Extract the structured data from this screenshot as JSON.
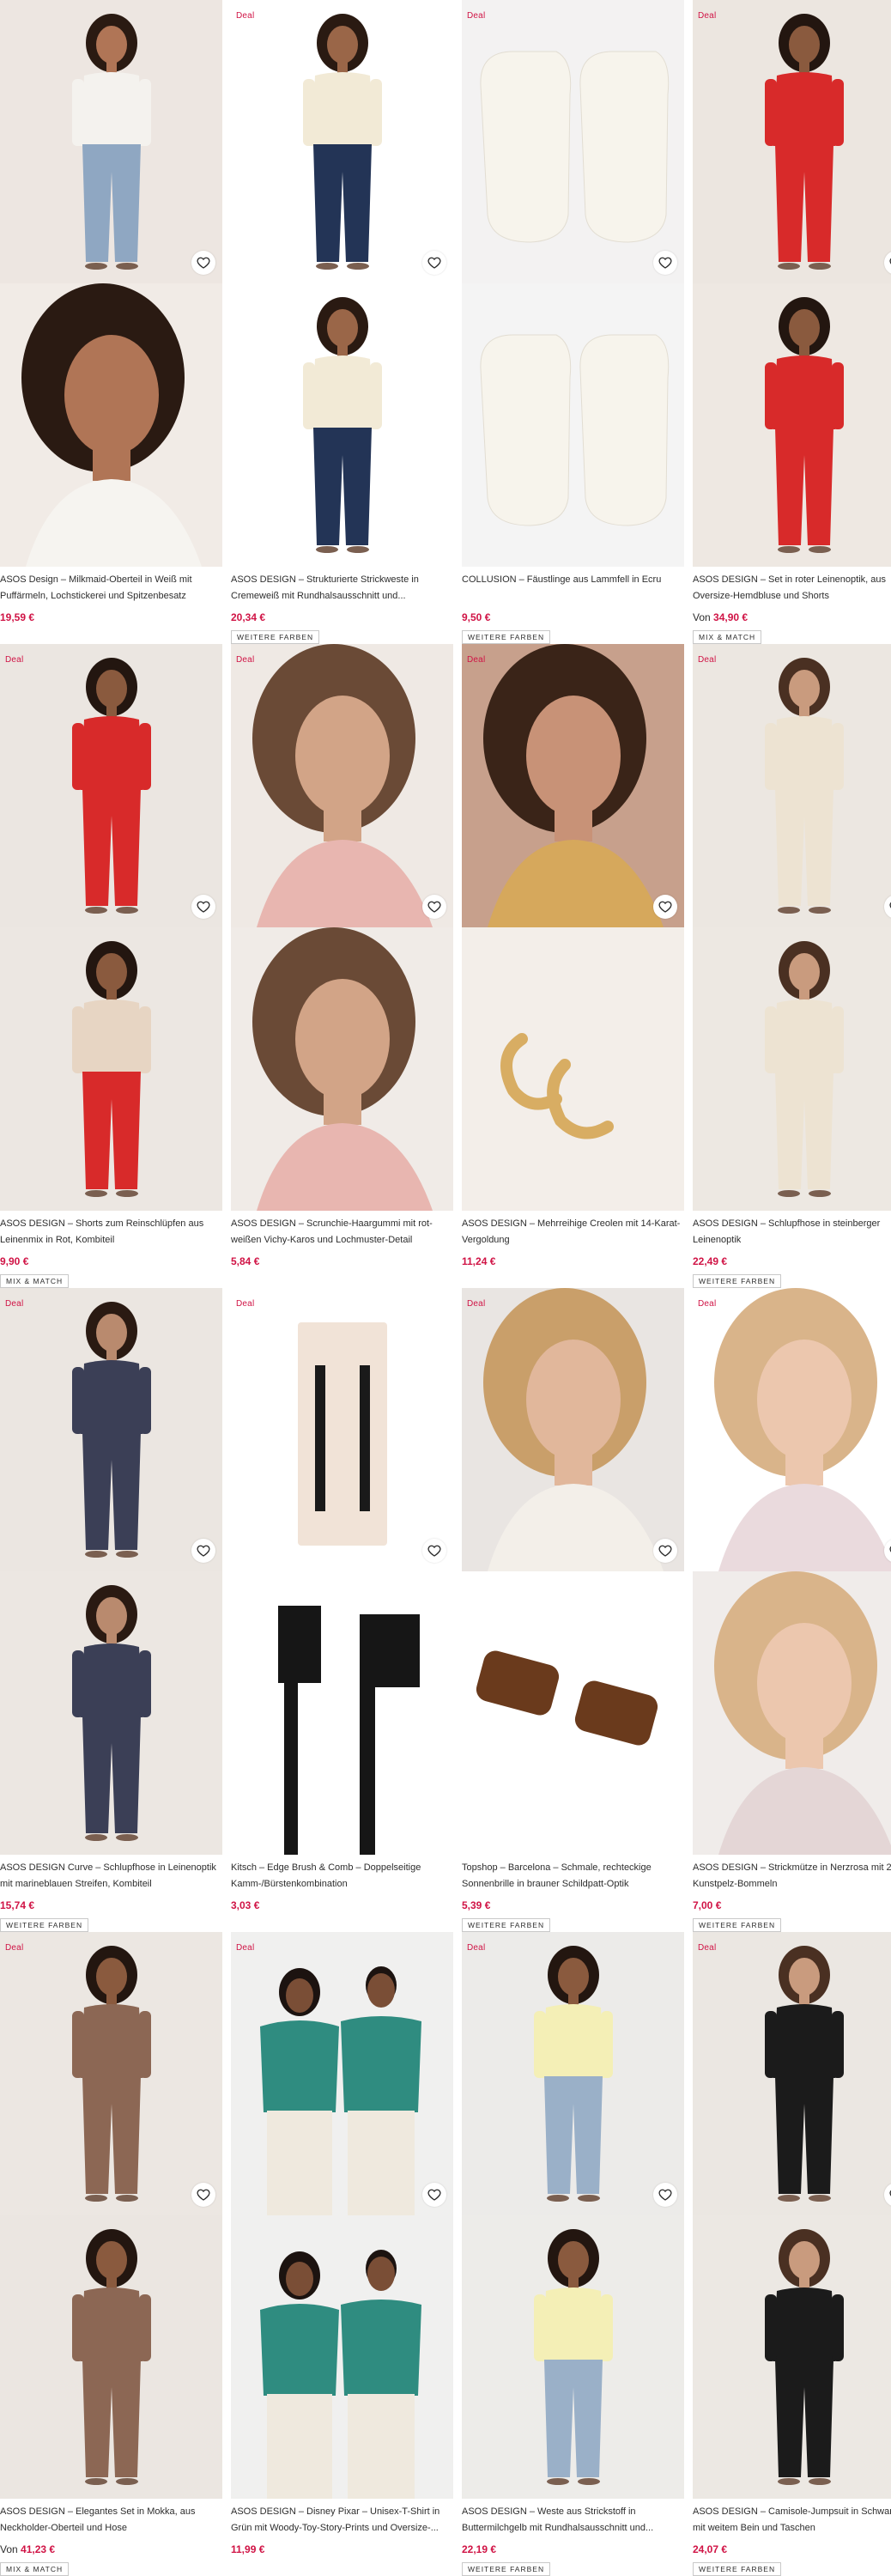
{
  "colors": {
    "accent": "#d01345",
    "text": "#2d2d2d"
  },
  "labels": {
    "deal": "Deal"
  },
  "products": [
    {
      "title": "ASOS Design – Milkmaid-Oberteil in Weiß mit Puffärmeln, Lochstickerei und Spitzenbesatz",
      "price": "19,59 €",
      "price_prefix": "",
      "tag": "",
      "deal": false,
      "top": {
        "bg": "#ede6e1",
        "fig": "woman",
        "skin": "#b07556",
        "hair": "#2a1a12",
        "cloth": "#f4f2ee",
        "pants": "#8fa7c2"
      },
      "bottom": {
        "bg": "#f1ebe6",
        "fig": "closeup",
        "skin": "#b07556",
        "hair": "#2a1a12",
        "cloth": "#f6f4f0",
        "pants": "#f6f4f0"
      }
    },
    {
      "title": "ASOS DESIGN – Strukturierte Strickweste in Cremeweiß mit Rundhalsausschnitt und...",
      "price": "20,34 €",
      "price_prefix": "",
      "tag": "WEITERE FARBEN",
      "deal": true,
      "top": {
        "bg": "#ffffff",
        "fig": "woman",
        "skin": "#9a6648",
        "hair": "#2a1a12",
        "cloth": "#f2ead6",
        "pants": "#233456"
      },
      "bottom": {
        "bg": "#ffffff",
        "fig": "woman",
        "skin": "#9a6648",
        "hair": "#2a1a12",
        "cloth": "#f2ead6",
        "pants": "#233456"
      }
    },
    {
      "title": "COLLUSION – Fäustlinge aus Lammfell in Ecru",
      "price": "9,50 €",
      "price_prefix": "",
      "tag": "WEITERE FARBEN",
      "deal": true,
      "top": {
        "bg": "#f3f2f2",
        "fig": "mittens",
        "skin": "",
        "hair": "",
        "cloth": "#f7f4ec",
        "pants": ""
      },
      "bottom": {
        "bg": "#f4f4f4",
        "fig": "mittens",
        "skin": "",
        "hair": "",
        "cloth": "#f7f4ec",
        "pants": ""
      }
    },
    {
      "title": "ASOS DESIGN – Set in roter Leinenoptik, aus Oversize-Hemdbluse und Shorts",
      "price": "34,90 €",
      "price_prefix": "Von",
      "tag": "MIX & MATCH",
      "deal": true,
      "top": {
        "bg": "#ece6e0",
        "fig": "woman",
        "skin": "#8a5a3e",
        "hair": "#231610",
        "cloth": "#d82a2a",
        "pants": "#d82a2a"
      },
      "bottom": {
        "bg": "#eee8e2",
        "fig": "woman",
        "skin": "#8a5a3e",
        "hair": "#231610",
        "cloth": "#d82a2a",
        "pants": "#d82a2a"
      }
    },
    {
      "title": "ASOS DESIGN – Shorts zum Reinschlüpfen aus Leinenmix in Rot, Kombiteil",
      "price": "9,90 €",
      "price_prefix": "",
      "tag": "MIX & MATCH",
      "deal": true,
      "top": {
        "bg": "#ebe6e1",
        "fig": "woman",
        "skin": "#8a5a3e",
        "hair": "#231610",
        "cloth": "#d82a2a",
        "pants": "#d82a2a"
      },
      "bottom": {
        "bg": "#ece7e2",
        "fig": "woman",
        "skin": "#8a5a3e",
        "hair": "#231610",
        "cloth": "#e7d5c3",
        "pants": "#d82a2a"
      }
    },
    {
      "title": "ASOS DESIGN – Scrunchie-Haargummi mit rot-weißen Vichy-Karos und Lochmuster-Detail",
      "price": "5,84 €",
      "price_prefix": "",
      "tag": "",
      "deal": true,
      "top": {
        "bg": "#efe9e4",
        "fig": "closeup",
        "skin": "#d2a487",
        "hair": "#6a4a36",
        "cloth": "#e8b6b0",
        "pants": "#e8b6b0"
      },
      "bottom": {
        "bg": "#f0ebe7",
        "fig": "closeup",
        "skin": "#d2a487",
        "hair": "#6a4a36",
        "cloth": "#e8b6b0",
        "pants": "#e8b6b0"
      }
    },
    {
      "title": "ASOS DESIGN – Mehrreihige Creolen mit 14-Karat-Vergoldung",
      "price": "11,24 €",
      "price_prefix": "",
      "tag": "",
      "deal": true,
      "top": {
        "bg": "#c7a08c",
        "fig": "closeup",
        "skin": "#c89277",
        "hair": "#3a2418",
        "cloth": "#d6a85c",
        "pants": "#d6a85c"
      },
      "bottom": {
        "bg": "#f3eee9",
        "fig": "earrings",
        "skin": "",
        "hair": "",
        "cloth": "#d8ad63",
        "pants": ""
      }
    },
    {
      "title": "ASOS DESIGN – Schlupfhose in steinberger Leinenoptik",
      "price": "22,49 €",
      "price_prefix": "",
      "tag": "WEITERE FARBEN",
      "deal": true,
      "top": {
        "bg": "#ece7e1",
        "fig": "woman",
        "skin": "#c99b7e",
        "hair": "#4a3022",
        "cloth": "#ede3d2",
        "pants": "#ede3d2"
      },
      "bottom": {
        "bg": "#ede8e2",
        "fig": "woman",
        "skin": "#c99b7e",
        "hair": "#4a3022",
        "cloth": "#ede3d2",
        "pants": "#ede3d2"
      }
    },
    {
      "title": "ASOS DESIGN Curve – Schlupfhose in Leinenoptik mit marineblauen Streifen, Kombiteil",
      "price": "15,74 €",
      "price_prefix": "",
      "tag": "WEITERE FARBEN",
      "deal": true,
      "top": {
        "bg": "#ebe6e1",
        "fig": "woman",
        "skin": "#b98a6e",
        "hair": "#2a1a12",
        "cloth": "#3b3f56",
        "pants": "#3b3f56"
      },
      "bottom": {
        "bg": "#ece7e2",
        "fig": "woman",
        "skin": "#b98a6e",
        "hair": "#2a1a12",
        "cloth": "#3b3f56",
        "pants": "#3b3f56"
      }
    },
    {
      "title": "Kitsch – Edge Brush & Comb – Doppelseitige Kamm-/Bürstenkombination",
      "price": "3,03 €",
      "price_prefix": "",
      "tag": "",
      "deal": true,
      "top": {
        "bg": "#ffffff",
        "fig": "package",
        "skin": "",
        "hair": "",
        "cloth": "#f1e3d7",
        "pants": ""
      },
      "bottom": {
        "bg": "#ffffff",
        "fig": "comb",
        "skin": "",
        "hair": "",
        "cloth": "#161616",
        "pants": ""
      }
    },
    {
      "title": "Topshop – Barcelona – Schmale, rechteckige Sonnenbrille in brauner Schildpatt-Optik",
      "price": "5,39 €",
      "price_prefix": "",
      "tag": "WEITERE FARBEN",
      "deal": true,
      "top": {
        "bg": "#e9e5e2",
        "fig": "closeup",
        "skin": "#e1b79b",
        "hair": "#c99f6a",
        "cloth": "#f3efe9",
        "pants": "#f3efe9"
      },
      "bottom": {
        "bg": "#ffffff",
        "fig": "sunglasses",
        "skin": "",
        "hair": "",
        "cloth": "#6a3a1c",
        "pants": ""
      }
    },
    {
      "title": "ASOS DESIGN – Strickmütze in Nerzrosa mit 2 Kunstpelz-Bommeln",
      "price": "7,00 €",
      "price_prefix": "",
      "tag": "WEITERE FARBEN",
      "deal": true,
      "top": {
        "bg": "#ffffff",
        "fig": "closeup",
        "skin": "#ecc7ae",
        "hair": "#d9b48a",
        "cloth": "#eadadd",
        "pants": "#eadadd"
      },
      "bottom": {
        "bg": "#f0ecea",
        "fig": "closeup",
        "skin": "#ecc7ae",
        "hair": "#d9b48a",
        "cloth": "#e4d6d6",
        "pants": "#f3c4d9"
      }
    },
    {
      "title": "ASOS DESIGN – Elegantes Set in Mokka, aus Neckholder-Oberteil und Hose",
      "price": "41,23 €",
      "price_prefix": "Von",
      "tag": "MIX & MATCH",
      "deal": true,
      "top": {
        "bg": "#ece7e2",
        "fig": "woman",
        "skin": "#8a5a3e",
        "hair": "#231610",
        "cloth": "#8c6754",
        "pants": "#8c6754"
      },
      "bottom": {
        "bg": "#ebe6e1",
        "fig": "woman",
        "skin": "#8a5a3e",
        "hair": "#231610",
        "cloth": "#8c6754",
        "pants": "#8c6754"
      }
    },
    {
      "title": "ASOS DESIGN – Disney Pixar – Unisex-T-Shirt in Grün mit Woody-Toy-Story-Prints und Oversize-...",
      "price": "11,99 €",
      "price_prefix": "",
      "tag": "",
      "deal": true,
      "top": {
        "bg": "#f0f0ef",
        "fig": "couple",
        "skin": "#7a4e36",
        "hair": "#1c1310",
        "cloth": "#2f8c80",
        "pants": "#efe9de"
      },
      "bottom": {
        "bg": "#f0f0ef",
        "fig": "couple",
        "skin": "#7a4e36",
        "hair": "#1c1310",
        "cloth": "#2f8c80",
        "pants": "#efe9de"
      }
    },
    {
      "title": "ASOS DESIGN – Weste aus Strickstoff in Buttermilchgelb mit Rundhalsausschnitt und...",
      "price": "22,19 €",
      "price_prefix": "",
      "tag": "WEITERE FARBEN",
      "deal": true,
      "top": {
        "bg": "#ecebe9",
        "fig": "woman",
        "skin": "#8a5a3e",
        "hair": "#231610",
        "cloth": "#f4efb6",
        "pants": "#9ab0c8"
      },
      "bottom": {
        "bg": "#edece9",
        "fig": "woman",
        "skin": "#8a5a3e",
        "hair": "#231610",
        "cloth": "#f4efb6",
        "pants": "#9ab0c8"
      }
    },
    {
      "title": "ASOS DESIGN – Camisole-Jumpsuit in Schwarz mit weitem Bein und Taschen",
      "price": "24,07 €",
      "price_prefix": "",
      "tag": "WEITERE FARBEN",
      "deal": true,
      "top": {
        "bg": "#ebe7e2",
        "fig": "woman",
        "skin": "#c99b7e",
        "hair": "#4a3022",
        "cloth": "#1b1b1b",
        "pants": "#1b1b1b"
      },
      "bottom": {
        "bg": "#ece8e3",
        "fig": "woman",
        "skin": "#c99b7e",
        "hair": "#4a3022",
        "cloth": "#1b1b1b",
        "pants": "#1b1b1b"
      }
    }
  ]
}
